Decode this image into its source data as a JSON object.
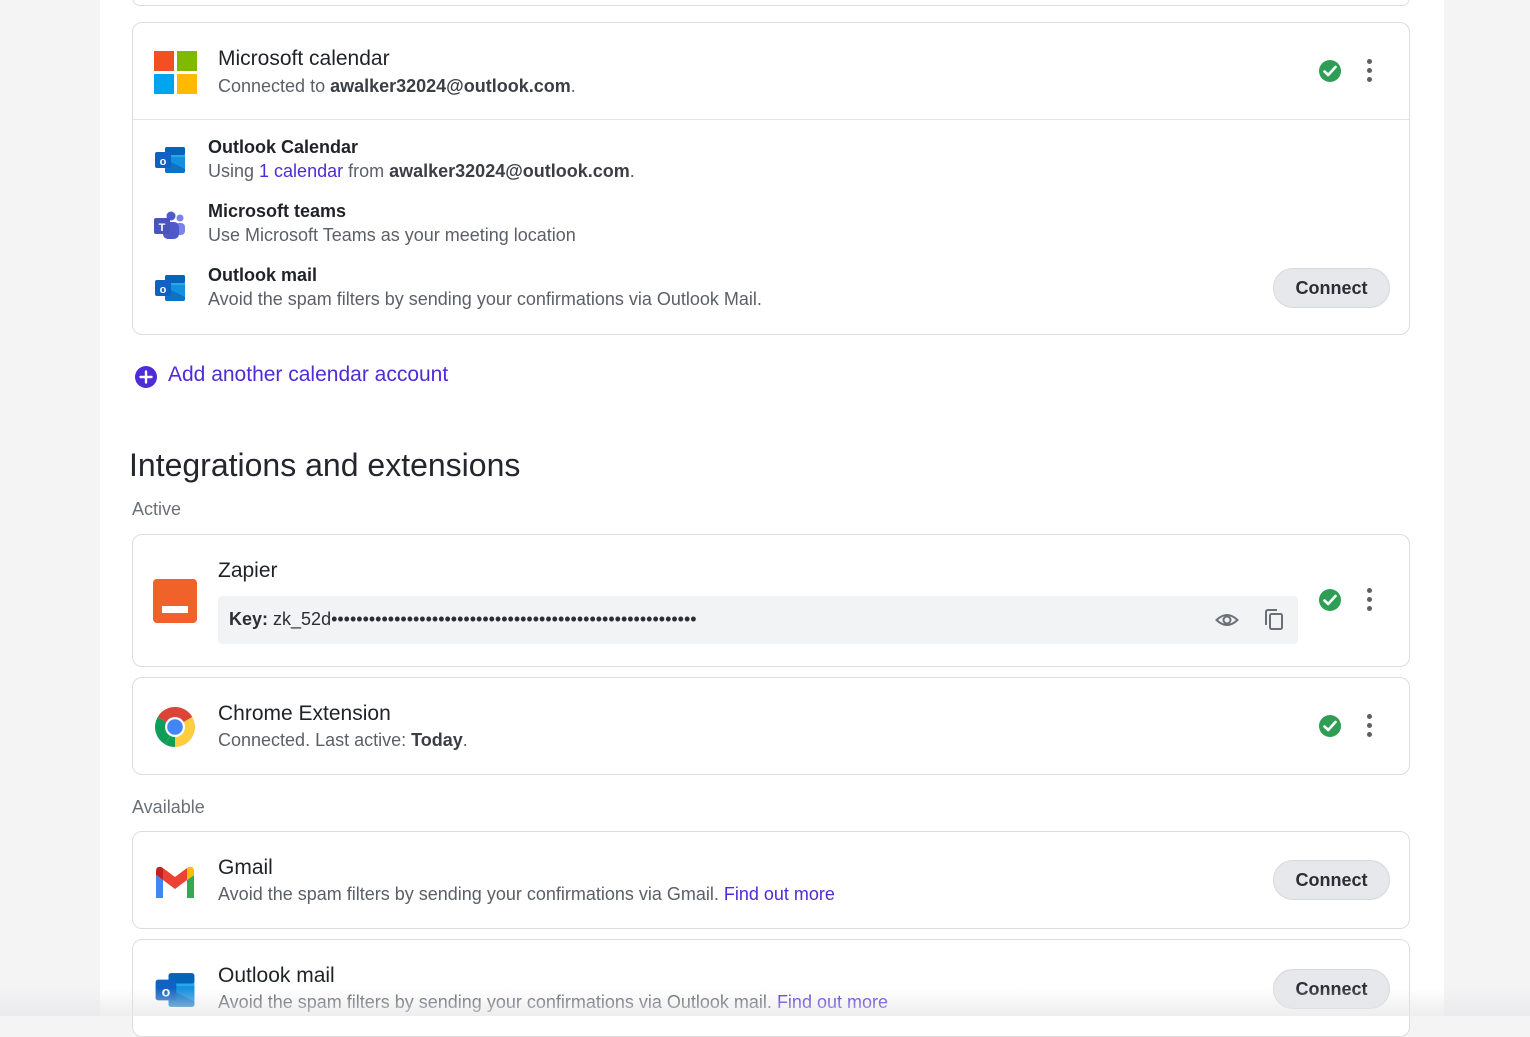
{
  "microsoft": {
    "title": "Microsoft calendar",
    "connected_prefix": "Connected to ",
    "email": "awalker32024@outlook.com",
    "period": ".",
    "items": [
      {
        "title": "Outlook Calendar",
        "using": "Using ",
        "calendar_link": "1 calendar",
        "from": " from ",
        "email": "awalker32024@outlook.com",
        "period": "."
      },
      {
        "title": "Microsoft teams",
        "desc": "Use Microsoft Teams as your meeting location"
      },
      {
        "title": "Outlook mail",
        "desc": "Avoid the spam filters by sending your confirmations via Outlook Mail.",
        "button": "Connect"
      }
    ]
  },
  "add_calendar": "Add another calendar account",
  "integrations": {
    "title": "Integrations and extensions",
    "active_label": "Active",
    "available_label": "Available",
    "zapier": {
      "title": "Zapier",
      "key_label": "Key:",
      "key_value": "zk_52d••••••••••••••••••••••••••••••••••••••••••••••••••••••••••"
    },
    "chrome": {
      "title": "Chrome Extension",
      "status_prefix": "Connected. Last active: ",
      "status_value": "Today",
      "period": "."
    },
    "gmail": {
      "title": "Gmail",
      "desc": "Avoid the spam filters by sending your confirmations via Gmail. ",
      "link": "Find out more",
      "button": "Connect"
    },
    "outlook": {
      "title": "Outlook mail",
      "desc": "Avoid the spam filters by sending your confirmations via Outlook mail. ",
      "link": "Find out more",
      "button": "Connect"
    }
  },
  "colors": {
    "accent": "#4f2bd9",
    "success": "#2e9e55",
    "zapier": "#f0622a"
  }
}
